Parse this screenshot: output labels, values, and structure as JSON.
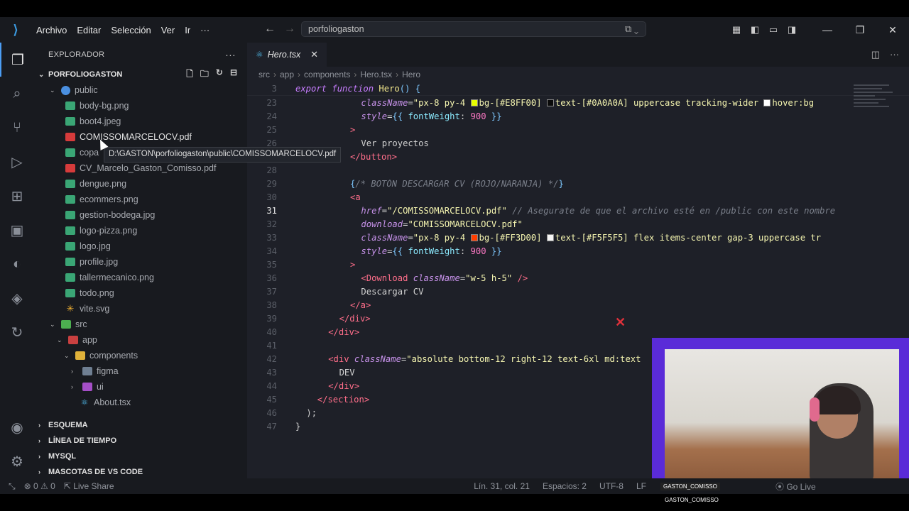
{
  "titlebar": {
    "menu": [
      "Archivo",
      "Editar",
      "Selección",
      "Ver",
      "Ir",
      "···"
    ],
    "search_text": "porfoliogaston"
  },
  "sidebar": {
    "title": "EXPLORADOR",
    "project": "PORFOLIOGASTON",
    "tree": [
      {
        "name": "public",
        "type": "folder-blue",
        "level": 1,
        "open": true
      },
      {
        "name": "body-bg.png",
        "type": "img",
        "level": 2
      },
      {
        "name": "boot4.jpeg",
        "type": "img",
        "level": 2
      },
      {
        "name": "COMISSOMARCELOCV.pdf",
        "type": "pdf",
        "level": 2,
        "hover": true
      },
      {
        "name": "copa",
        "type": "img",
        "level": 2
      },
      {
        "name": "CV_Marcelo_Gaston_Comisso.pdf",
        "type": "pdf",
        "level": 2
      },
      {
        "name": "dengue.png",
        "type": "img",
        "level": 2
      },
      {
        "name": "ecommers.png",
        "type": "img",
        "level": 2
      },
      {
        "name": "gestion-bodega.jpg",
        "type": "img",
        "level": 2
      },
      {
        "name": "logo-pizza.png",
        "type": "img",
        "level": 2
      },
      {
        "name": "logo.jpg",
        "type": "img",
        "level": 2
      },
      {
        "name": "profile.jpg",
        "type": "img",
        "level": 2
      },
      {
        "name": "tallermecanico.png",
        "type": "img",
        "level": 2
      },
      {
        "name": "todo.png",
        "type": "img",
        "level": 2
      },
      {
        "name": "vite.svg",
        "type": "svg",
        "level": 2
      },
      {
        "name": "src",
        "type": "folder-green",
        "level": 1,
        "open": true
      },
      {
        "name": "app",
        "type": "folder-red",
        "level": 2,
        "open": true
      },
      {
        "name": "components",
        "type": "folder-yel",
        "level": 3,
        "open": true
      },
      {
        "name": "figma",
        "type": "folder-grey",
        "level": 4,
        "open": false
      },
      {
        "name": "ui",
        "type": "folder-pur",
        "level": 4,
        "open": false
      },
      {
        "name": "About.tsx",
        "type": "tsx",
        "level": 4
      }
    ],
    "tooltip": "D:\\GASTON\\porfoliogaston\\public\\COMISSOMARCELOCV.pdf",
    "sections": [
      "ESQUEMA",
      "LÍNEA DE TIEMPO",
      "MYSQL",
      "MASCOTAS DE VS CODE"
    ]
  },
  "editor": {
    "tab": "Hero.tsx",
    "breadcrumb": [
      "src",
      "app",
      "components",
      "Hero.tsx",
      "Hero"
    ],
    "sticky_line_no": "3",
    "lines": [
      {
        "n": "23",
        "indent": 12,
        "html": "<span class='attr'>className</span>=<span class='str'>\"px-8 py-4 </span><span class='swatch' style='background:#E8FF00'></span><span class='str'>bg-[#E8FF00] </span><span class='swatch' style='background:#0A0A0A'></span><span class='str'>text-[#0A0A0A] uppercase tracking-wider </span><span class='swatch' style='background:#fff'></span><span class='str'>hover:bg</span>"
      },
      {
        "n": "24",
        "indent": 12,
        "html": "<span class='attr'>style</span>=<span class='brace'>{{</span> <span class='prop'>fontWeight</span>: <span class='num'>900</span> <span class='brace'>}}</span>"
      },
      {
        "n": "25",
        "indent": 10,
        "html": "<span class='tag'>&gt;</span>"
      },
      {
        "n": "26",
        "indent": 12,
        "html": "Ver proyectos"
      },
      {
        "n": "27",
        "indent": 10,
        "html": "<span class='tag'>&lt;/button&gt;</span>"
      },
      {
        "n": "28",
        "indent": 0,
        "html": ""
      },
      {
        "n": "29",
        "indent": 10,
        "html": "<span class='brace'>{</span><span class='cmt'>/* BOTÓN DESCARGAR CV (ROJO/NARANJA) */</span><span class='brace'>}</span>"
      },
      {
        "n": "30",
        "indent": 10,
        "html": "<span class='tag'>&lt;a</span>"
      },
      {
        "n": "31",
        "indent": 12,
        "html": "<span class='attr'>href</span>=<span class='str'>\"/COMISSOMARCELOCV.pdf\"</span> <span class='cmt'>// Asegurate de que el archivo esté en /public con este nombre</span>",
        "current": true
      },
      {
        "n": "32",
        "indent": 12,
        "html": "<span class='attr'>download</span>=<span class='str'>\"COMISSOMARCELOCV.pdf\"</span>"
      },
      {
        "n": "33",
        "indent": 12,
        "html": "<span class='attr'>className</span>=<span class='str'>\"px-8 py-4 </span><span class='swatch' style='background:#FF3D00'></span><span class='str'>bg-[#FF3D00] </span><span class='swatch' style='background:#F5F5F5'></span><span class='str'>text-[#F5F5F5] flex items-center gap-3 uppercase tr</span>"
      },
      {
        "n": "34",
        "indent": 12,
        "html": "<span class='attr'>style</span>=<span class='brace'>{{</span> <span class='prop'>fontWeight</span>: <span class='num'>900</span> <span class='brace'>}}</span>"
      },
      {
        "n": "35",
        "indent": 10,
        "html": "<span class='tag'>&gt;</span>"
      },
      {
        "n": "36",
        "indent": 12,
        "html": "<span class='tag'>&lt;Download</span> <span class='attr'>className</span>=<span class='str'>\"w-5 h-5\"</span> <span class='tag'>/&gt;</span>"
      },
      {
        "n": "37",
        "indent": 12,
        "html": "Descargar CV"
      },
      {
        "n": "38",
        "indent": 10,
        "html": "<span class='tag'>&lt;/a&gt;</span>"
      },
      {
        "n": "39",
        "indent": 8,
        "html": "<span class='tag'>&lt;/div&gt;</span>"
      },
      {
        "n": "40",
        "indent": 6,
        "html": "<span class='tag'>&lt;/div&gt;</span>"
      },
      {
        "n": "41",
        "indent": 0,
        "html": ""
      },
      {
        "n": "42",
        "indent": 6,
        "html": "<span class='tag'>&lt;div</span> <span class='attr'>className</span>=<span class='str'>\"absolute bottom-12 right-12 text-6xl md:text</span>"
      },
      {
        "n": "43",
        "indent": 8,
        "html": "DEV"
      },
      {
        "n": "44",
        "indent": 6,
        "html": "<span class='tag'>&lt;/div&gt;</span>"
      },
      {
        "n": "45",
        "indent": 4,
        "html": "<span class='tag'>&lt;/section&gt;</span>"
      },
      {
        "n": "46",
        "indent": 2,
        "html": ");"
      },
      {
        "n": "47",
        "indent": 0,
        "html": "}"
      }
    ]
  },
  "statusbar": {
    "errors": "0",
    "warnings": "0",
    "live_share": "Live Share",
    "position": "Lín. 31, col. 21",
    "spaces": "Espacios: 2",
    "encoding": "UTF-8",
    "eol": "LF",
    "go_live": "Go Live"
  },
  "overlay": {
    "channel_tag": "GASTON_COMISSO"
  }
}
